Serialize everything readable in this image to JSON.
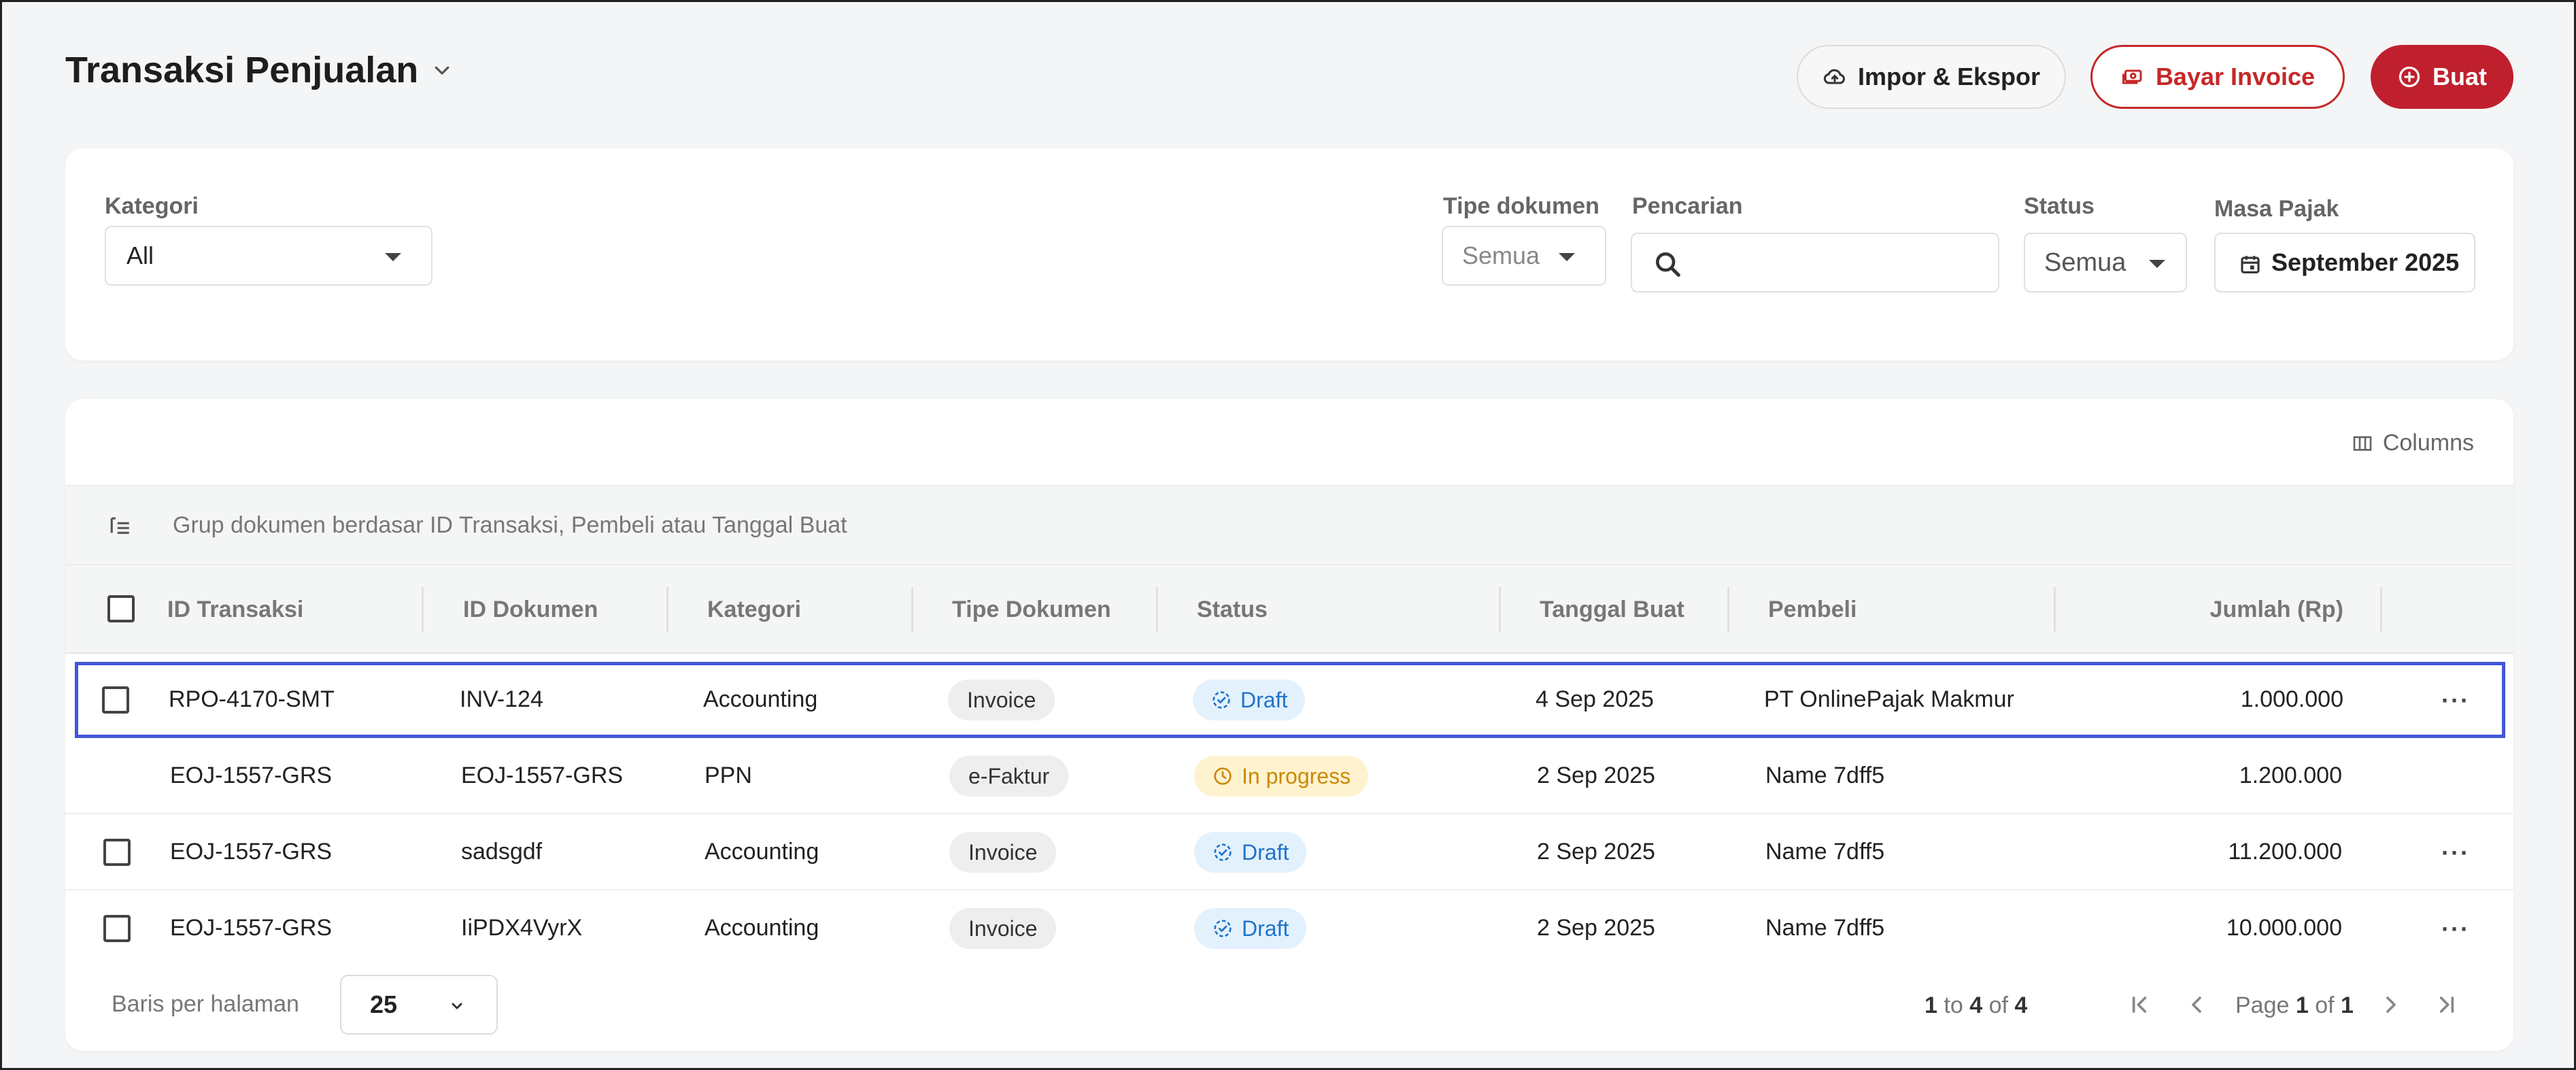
{
  "header": {
    "title": "Transaksi Penjualan",
    "impor_label": "Impor & Ekspor",
    "bayar_label": "Bayar Invoice",
    "buat_label": "Buat"
  },
  "filters": {
    "kategori_label": "Kategori",
    "kategori_value": "All",
    "tipe_label": "Tipe dokumen",
    "tipe_value": "Semua",
    "pencarian_label": "Pencarian",
    "pencarian_value": "",
    "status_label": "Status",
    "status_value": "Semua",
    "masa_label": "Masa Pajak",
    "masa_value": "September 2025"
  },
  "table": {
    "columns_label": "Columns",
    "group_hint": "Grup dokumen berdasar ID Transaksi, Pembeli atau Tanggal Buat",
    "headers": [
      "ID Transaksi",
      "ID Dokumen",
      "Kategori",
      "Tipe Dokumen",
      "Status",
      "Tanggal Buat",
      "Pembeli",
      "Jumlah (Rp)"
    ],
    "rows": [
      {
        "id_transaksi": "RPO-4170-SMT",
        "id_dokumen": "INV-124",
        "kategori": "Accounting",
        "tipe": "Invoice",
        "status": "Draft",
        "tanggal": "4 Sep 2025",
        "pembeli": "PT OnlinePajak Makmur",
        "jumlah": "1.000.000"
      },
      {
        "id_transaksi": "EOJ-1557-GRS",
        "id_dokumen": "EOJ-1557-GRS",
        "kategori": "PPN",
        "tipe": "e-Faktur",
        "status": "In progress",
        "tanggal": "2 Sep 2025",
        "pembeli": "Name 7dff5",
        "jumlah": "1.200.000"
      },
      {
        "id_transaksi": "EOJ-1557-GRS",
        "id_dokumen": "sadsgdf",
        "kategori": "Accounting",
        "tipe": "Invoice",
        "status": "Draft",
        "tanggal": "2 Sep 2025",
        "pembeli": "Name 7dff5",
        "jumlah": "11.200.000"
      },
      {
        "id_transaksi": "EOJ-1557-GRS",
        "id_dokumen": "IiPDX4VyrX",
        "kategori": "Accounting",
        "tipe": "Invoice",
        "status": "Draft",
        "tanggal": "2 Sep 2025",
        "pembeli": "Name 7dff5",
        "jumlah": "10.000.000"
      }
    ],
    "row_menu": "···"
  },
  "footer": {
    "rows_per_page_label": "Baris per halaman",
    "rows_per_page_value": "25",
    "range_from": "1",
    "range_to_word": "to",
    "range_to": "4",
    "range_of_word": "of",
    "range_total": "4",
    "page_word": "Page",
    "page_current": "1",
    "page_of_word": "of",
    "page_total": "1"
  },
  "colors": {
    "accent_red": "#c0202d",
    "selection_blue": "#4357d6",
    "draft_blue": "#1f73c9",
    "progress_amber": "#c98a00"
  },
  "icons": {
    "title_chevron": "chevron-down-icon",
    "impor": "cloud-upload-icon",
    "bayar": "money-icon",
    "buat": "plus-circle-icon",
    "search": "search-icon",
    "calendar": "calendar-icon",
    "columns": "columns-icon",
    "group": "group-list-icon",
    "draft": "draft-status-icon",
    "progress": "clock-icon",
    "pagination": [
      "first-page-icon",
      "prev-page-icon",
      "next-page-icon",
      "last-page-icon"
    ]
  }
}
